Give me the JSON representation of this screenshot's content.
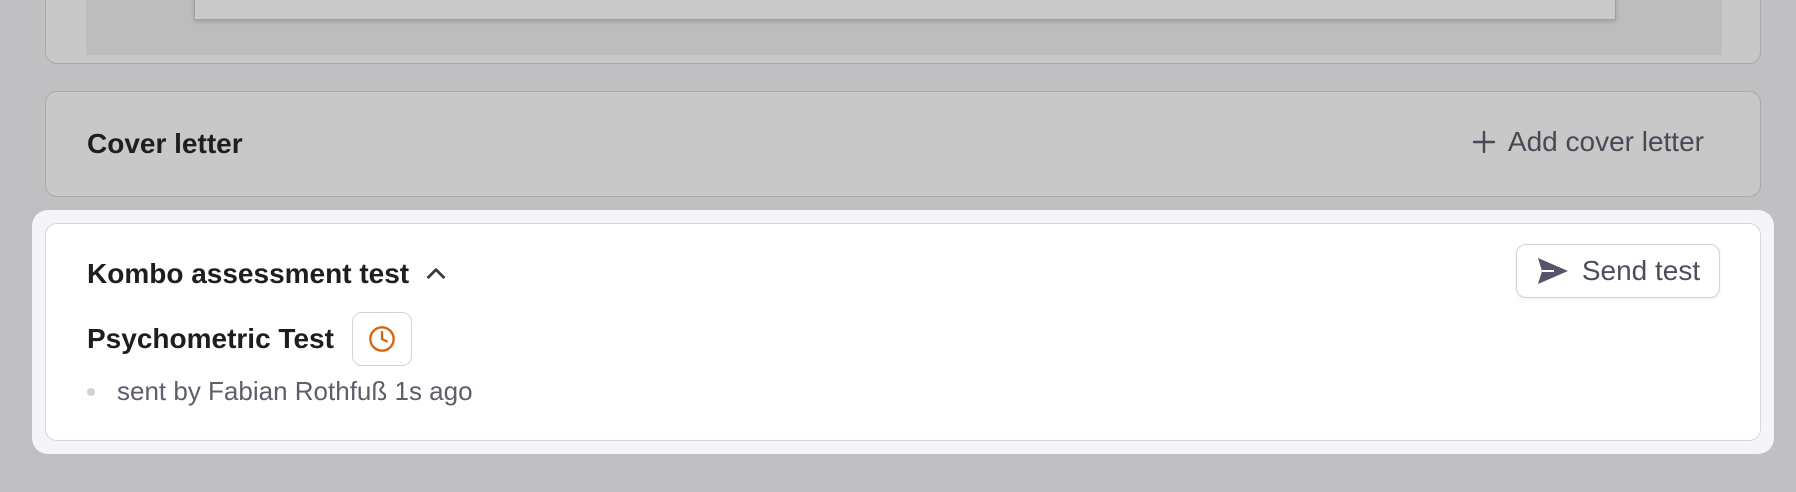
{
  "cover_letter": {
    "title": "Cover letter",
    "add_label": "Add cover letter"
  },
  "assessment": {
    "title": "Kombo assessment test",
    "send_label": "Send test",
    "test_name": "Psychometric Test",
    "meta": "sent by Fabian Rothfuß 1s ago",
    "status_icon": "clock-icon",
    "status_color": "#d9650b"
  },
  "colors": {
    "backdrop": "#c0c0c2",
    "card_border": "#d7d6e0",
    "text_primary": "#1d1d22",
    "text_secondary": "#5f5d6b"
  }
}
